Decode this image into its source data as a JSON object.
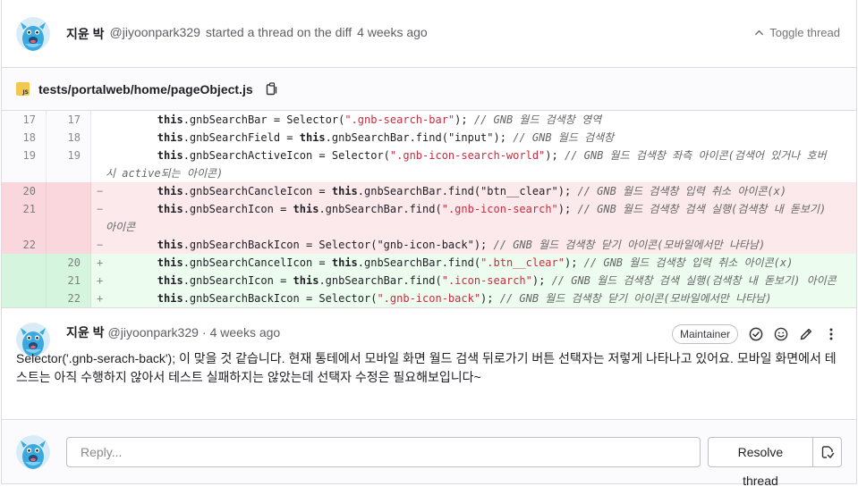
{
  "thread": {
    "author_name": "지윤 박",
    "author_handle": "@jiyoonpark329",
    "action_text": "started a thread on the diff",
    "time_ago": "4 weeks ago",
    "toggle_label": "Toggle thread"
  },
  "file": {
    "path": "tests/portalweb/home/pageObject.js",
    "icon": "js-file-icon"
  },
  "diff_rows": [
    {
      "type": "ctx",
      "old": "17",
      "new": "17",
      "sign": "",
      "parts": [
        [
          "",
          "        "
        ],
        [
          "kw",
          "this"
        ],
        [
          "",
          ".gnbSearchBar = Selector("
        ],
        [
          "str",
          "\".gnb-search-bar\""
        ],
        [
          "",
          "); "
        ],
        [
          "cm",
          "// GNB 월드 검색창 영역"
        ]
      ]
    },
    {
      "type": "ctx",
      "old": "18",
      "new": "18",
      "sign": "",
      "parts": [
        [
          "",
          "        "
        ],
        [
          "kw",
          "this"
        ],
        [
          "",
          ".gnbSearchField = "
        ],
        [
          "kw",
          "this"
        ],
        [
          "",
          ".gnbSearchBar.find("
        ],
        [
          "",
          "\"input\""
        ],
        [
          "",
          "); "
        ],
        [
          "cm",
          "// GNB 월드 검색창"
        ]
      ]
    },
    {
      "type": "ctx",
      "old": "19",
      "new": "19",
      "sign": "",
      "parts": [
        [
          "",
          "        "
        ],
        [
          "kw",
          "this"
        ],
        [
          "",
          ".gnbSearchActiveIcon = Selector("
        ],
        [
          "str",
          "\".gnb-icon-search-world\""
        ],
        [
          "",
          "); "
        ],
        [
          "cm",
          "// GNB 월드 검색창 좌측 아이콘(검색어 있거나 호버 시 active되는 아이콘)"
        ]
      ]
    },
    {
      "type": "old",
      "old": "20",
      "new": "",
      "sign": "−",
      "parts": [
        [
          "",
          "        "
        ],
        [
          "kw",
          "this"
        ],
        [
          "",
          ".gnbSearchCancleIcon = "
        ],
        [
          "kw",
          "this"
        ],
        [
          "",
          ".gnbSearchBar.find("
        ],
        [
          "",
          "\"btn__clear\""
        ],
        [
          "",
          "); "
        ],
        [
          "cm",
          "// GNB 월드 검색창 입력 취소 아이콘(x)"
        ]
      ]
    },
    {
      "type": "old",
      "old": "21",
      "new": "",
      "sign": "−",
      "parts": [
        [
          "",
          "        "
        ],
        [
          "kw",
          "this"
        ],
        [
          "",
          ".gnbSearchIcon = "
        ],
        [
          "kw",
          "this"
        ],
        [
          "",
          ".gnbSearchBar.find("
        ],
        [
          "str",
          "\".gnb-icon-search\""
        ],
        [
          "",
          "); "
        ],
        [
          "cm",
          "// GNB 월드 검색창 검색 실행(검색창 내 돋보기) 아이콘"
        ]
      ]
    },
    {
      "type": "old",
      "old": "22",
      "new": "",
      "sign": "−",
      "parts": [
        [
          "",
          "        "
        ],
        [
          "kw",
          "this"
        ],
        [
          "",
          ".gnbSearchBackIcon = Selector("
        ],
        [
          "",
          "\"gnb-icon-back\""
        ],
        [
          "",
          "); "
        ],
        [
          "cm",
          "// GNB 월드 검색창 닫기 아이콘(모바일에서만 나타남)"
        ]
      ]
    },
    {
      "type": "new-l",
      "old": "",
      "new": "20",
      "sign": "+",
      "parts": [
        [
          "",
          "        "
        ],
        [
          "kw",
          "this"
        ],
        [
          "",
          ".gnbSearchCancelIcon = "
        ],
        [
          "kw",
          "this"
        ],
        [
          "",
          ".gnbSearchBar.find("
        ],
        [
          "str",
          "\".btn__clear\""
        ],
        [
          "",
          "); "
        ],
        [
          "cm",
          "// GNB 월드 검색창 입력 취소 아이콘(x)"
        ]
      ]
    },
    {
      "type": "new-l",
      "old": "",
      "new": "21",
      "sign": "+",
      "parts": [
        [
          "",
          "        "
        ],
        [
          "kw",
          "this"
        ],
        [
          "",
          ".gnbSearchIcon = "
        ],
        [
          "kw",
          "this"
        ],
        [
          "",
          ".gnbSearchBar.find("
        ],
        [
          "str",
          "\".icon-search\""
        ],
        [
          "",
          "); "
        ],
        [
          "cm",
          "// GNB 월드 검색창 검색 실행(검색창 내 돋보기) 아이콘"
        ]
      ]
    },
    {
      "type": "new-l",
      "old": "",
      "new": "22",
      "sign": "+",
      "parts": [
        [
          "",
          "        "
        ],
        [
          "kw",
          "this"
        ],
        [
          "",
          ".gnbSearchBackIcon = Selector("
        ],
        [
          "str",
          "\".gnb-icon-back\""
        ],
        [
          "",
          "); "
        ],
        [
          "cm",
          "// GNB 월드 검색창 닫기 아이콘(모바일에서만 나타남)"
        ]
      ]
    }
  ],
  "comment": {
    "author_name": "지윤 박",
    "author_handle": "@jiyoonpark329",
    "separator": "·",
    "time_ago": "4 weeks ago",
    "role_badge": "Maintainer",
    "text": "Selector('.gnb-serach-back'); 이 맞을 것 같습니다. 현재 통테에서 모바일 화면 월드 검색 뒤로가기 버튼 선택자는 저렇게 나타나고 있어요. 모바일 화면에서 테스트는 아직 수행하지 않아서 테스트 실패하지는 않았는데 선택자 수정은 필요해보입니다~",
    "actions": [
      "resolve-check-icon",
      "emoji-icon",
      "edit-pencil-icon",
      "more-vertical-icon"
    ]
  },
  "reply": {
    "placeholder": "Reply...",
    "resolve_label": "Resolve thread"
  },
  "colors": {
    "removed_bg": "#fbe9eb",
    "added_bg": "#ecfdf0",
    "string": "#c92c3d"
  }
}
